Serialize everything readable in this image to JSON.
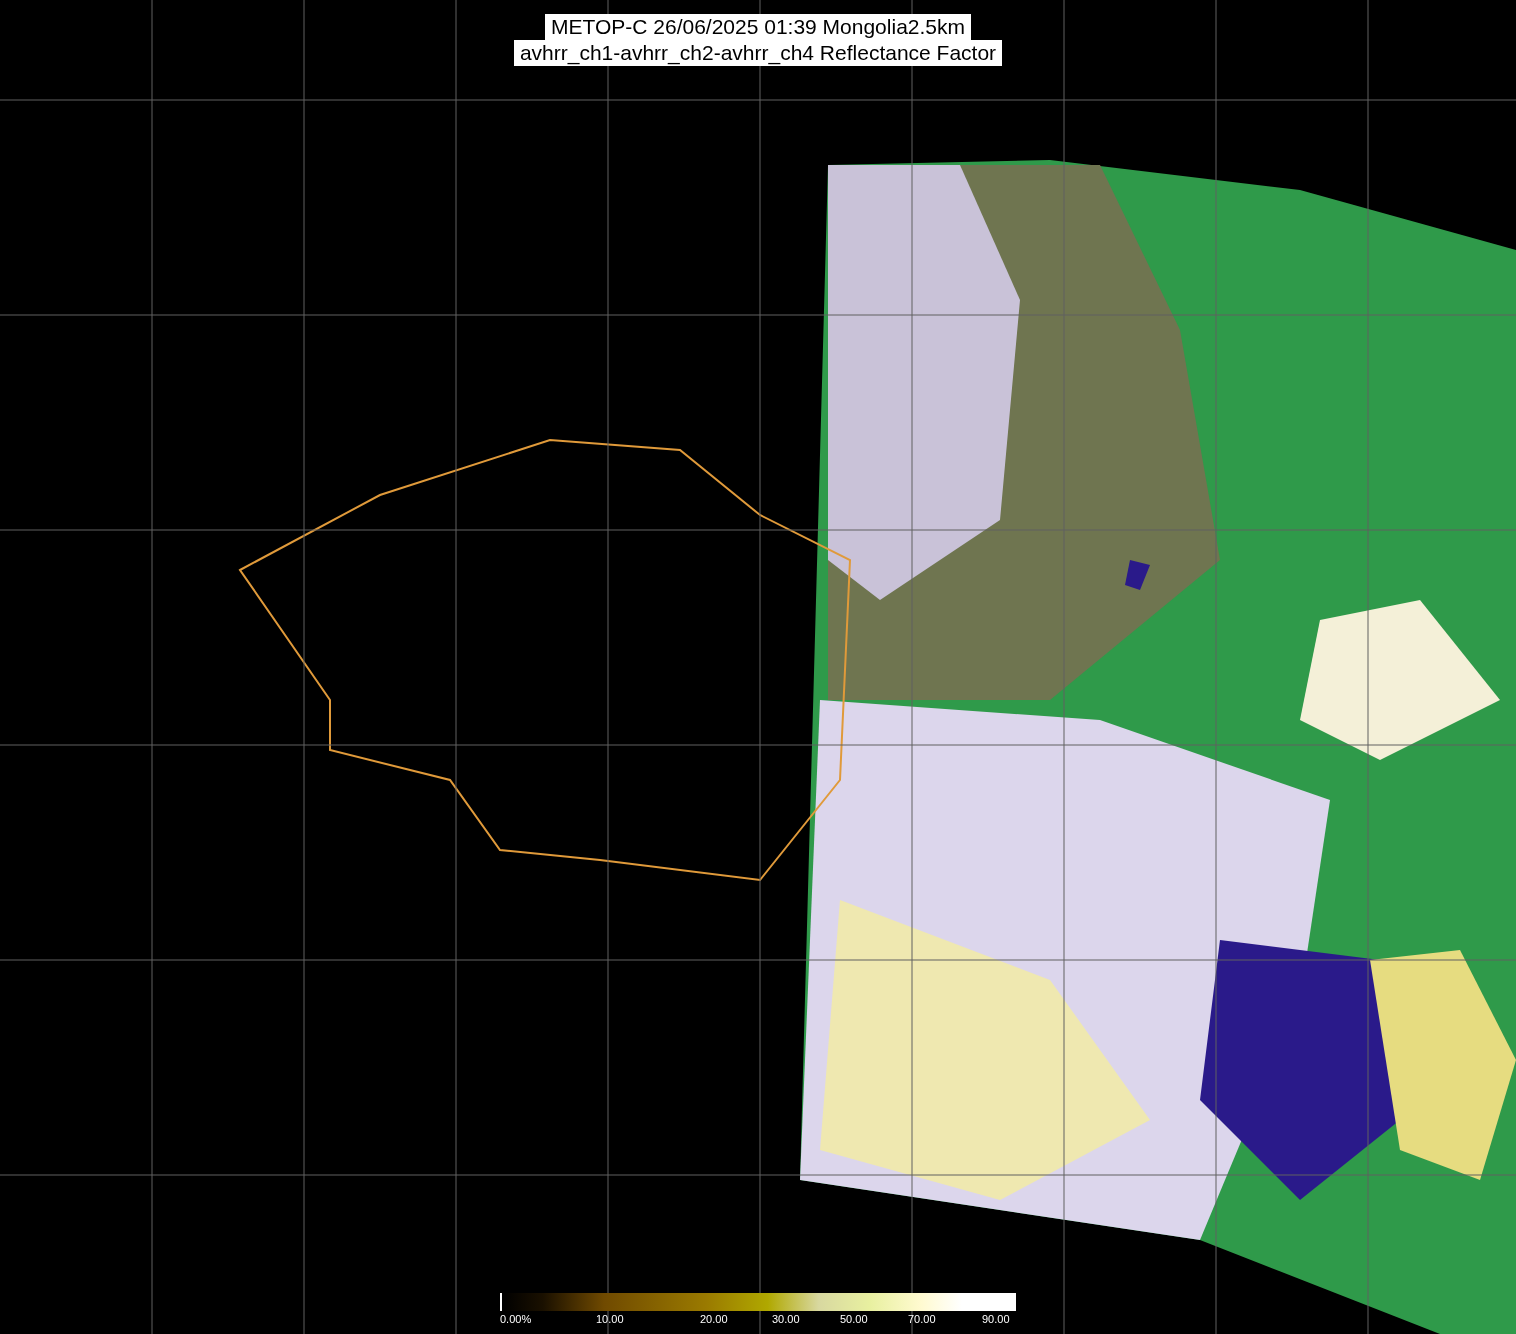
{
  "title": {
    "lines": [
      "METOP-C 26/06/2025 01:39 Mongolia2.5km",
      "avhrr_ch1-avhrr_ch2-avhrr_ch4 Reflectance Factor"
    ]
  },
  "colorbar": {
    "labels": [
      "0.00%",
      "10.00",
      "20.00",
      "30.00",
      "50.00",
      "70.00",
      "90.00"
    ]
  }
}
